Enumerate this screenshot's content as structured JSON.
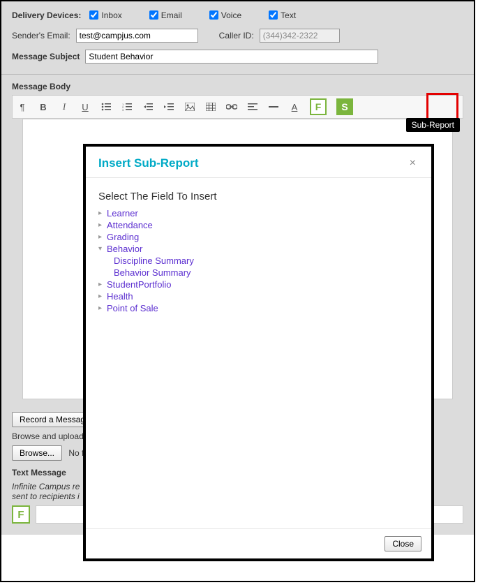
{
  "delivery": {
    "label": "Delivery Devices:",
    "options": [
      "Inbox",
      "Email",
      "Voice",
      "Text"
    ]
  },
  "sender": {
    "label": "Sender's Email:",
    "value": "test@campjus.com"
  },
  "caller": {
    "label": "Caller ID:",
    "value": "(344)342-2322"
  },
  "subject": {
    "label": "Message Subject",
    "value": "Student Behavior"
  },
  "body_label": "Message Body",
  "tooltip": "Sub-Report",
  "record_btn": "Record a Message",
  "browse_text": "Browse and upload",
  "browse_btn": "Browse...",
  "no_file": "No file",
  "text_msg_label": "Text Message",
  "text_msg_note1": "Infinite Campus re",
  "text_msg_note2": "sent to recipients i",
  "modal": {
    "title": "Insert Sub-Report",
    "select_label": "Select The Field To Insert",
    "tree": [
      {
        "label": "Learner",
        "expanded": false
      },
      {
        "label": "Attendance",
        "expanded": false
      },
      {
        "label": "Grading",
        "expanded": false
      },
      {
        "label": "Behavior",
        "expanded": true,
        "children": [
          "Discipline Summary",
          "Behavior Summary"
        ]
      },
      {
        "label": "StudentPortfolio",
        "expanded": false
      },
      {
        "label": "Health",
        "expanded": false
      },
      {
        "label": "Point of Sale",
        "expanded": false
      }
    ],
    "close_btn": "Close"
  }
}
